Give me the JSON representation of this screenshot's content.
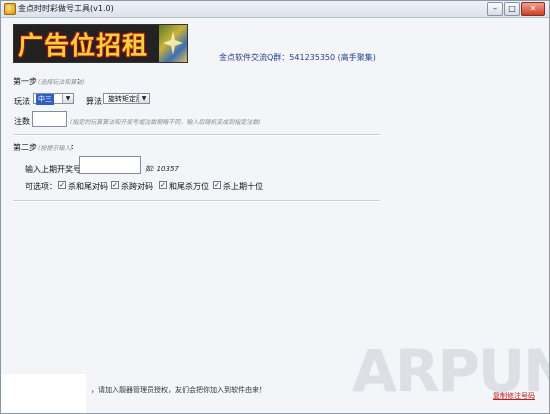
{
  "window": {
    "title": "金点时时彩做号工具(v1.0)"
  },
  "window_controls": {
    "minimize": "–",
    "maximize": "□",
    "close": "✕"
  },
  "banner": {
    "text": "广告位招租"
  },
  "qq_group": "金点软件交流Q群：541235350 (高手聚集)",
  "step1": {
    "title": "第一步",
    "hint": "(选择玩法和算法)",
    "colon": ":",
    "play_label": "玩法",
    "play_value": "中三",
    "algo_label": "算法",
    "algo_value": "旋转矩定胆",
    "count_label": "注数",
    "count_hint": "(指定的玩算算法和开奖号或注数期略不同，输入后随机变成到指定注数)"
  },
  "step2": {
    "title": "第二步",
    "hint": "(按提示输入)",
    "colon": ":",
    "last_draw_label": "输入上期开奖号",
    "example": "如: 10357",
    "options_label": "可选项：",
    "options": [
      {
        "label": "杀和尾对码",
        "checked": true
      },
      {
        "label": "杀跨对码",
        "checked": true
      },
      {
        "label": "和尾杀万位",
        "checked": true
      },
      {
        "label": "杀上期十位",
        "checked": true
      }
    ]
  },
  "status": {
    "text": "，请加入靓器管理员授权，友们会把你加入到软件由来！",
    "copy_link": "复制修注号码"
  },
  "watermark": "ARPUN"
}
